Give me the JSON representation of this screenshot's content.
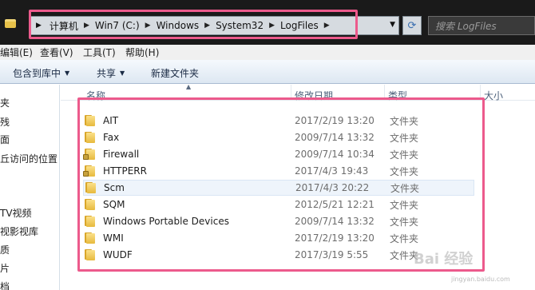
{
  "address_bar": {
    "crumbs": [
      "计算机",
      "Win7 (C:)",
      "Windows",
      "System32",
      "LogFiles"
    ]
  },
  "search": {
    "placeholder": "搜索 LogFiles"
  },
  "menu": {
    "items": [
      "编辑(E)",
      "查看(V)",
      "工具(T)",
      "帮助(H)"
    ]
  },
  "toolbar": {
    "include_library": "包含到库中",
    "share": "共享",
    "new_folder": "新建文件夹"
  },
  "nav": {
    "items": [
      "夹",
      "残",
      "面",
      "丘访问的位置",
      "TV视频",
      "视影视库",
      "质",
      "片",
      "档"
    ]
  },
  "columns": {
    "name": "名称",
    "modified": "修改日期",
    "type": "类型",
    "size": "大小"
  },
  "files": [
    {
      "name": "AIT",
      "date": "2017/2/19 13:20",
      "type": "文件夹",
      "locked": false
    },
    {
      "name": "Fax",
      "date": "2009/7/14 13:32",
      "type": "文件夹",
      "locked": false
    },
    {
      "name": "Firewall",
      "date": "2009/7/14 10:34",
      "type": "文件夹",
      "locked": true
    },
    {
      "name": "HTTPERR",
      "date": "2017/4/3 19:43",
      "type": "文件夹",
      "locked": true
    },
    {
      "name": "Scm",
      "date": "2017/4/3 20:22",
      "type": "文件夹",
      "locked": false
    },
    {
      "name": "SQM",
      "date": "2012/5/21 12:21",
      "type": "文件夹",
      "locked": false
    },
    {
      "name": "Windows Portable Devices",
      "date": "2009/7/14 13:32",
      "type": "文件夹",
      "locked": false
    },
    {
      "name": "WMI",
      "date": "2017/2/19 13:20",
      "type": "文件夹",
      "locked": false
    },
    {
      "name": "WUDF",
      "date": "2017/3/19 5:55",
      "type": "文件夹",
      "locked": false
    }
  ],
  "watermark": {
    "text": "Bai 经验",
    "sub": "jingyan.baidu.com"
  },
  "colors": {
    "highlight": "#ec5a8c",
    "folder": "#e7b93d"
  }
}
